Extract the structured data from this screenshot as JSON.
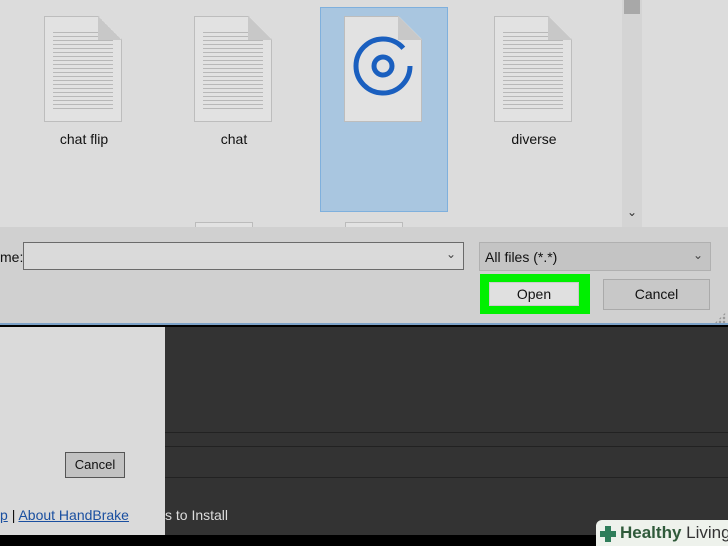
{
  "files": [
    {
      "name": "chat flip",
      "type": "text"
    },
    {
      "name": "chat",
      "type": "text"
    },
    {
      "name": "",
      "type": "groove-music",
      "selected": true
    },
    {
      "name": "diverse",
      "type": "text"
    }
  ],
  "dialog": {
    "filename_label": "me:",
    "filename_value": "",
    "filter": "All files (*.*)",
    "open_label": "Open",
    "cancel_label": "Cancel",
    "highlight_color": "#00f000"
  },
  "background_app": {
    "cancel_label": "Cancel",
    "link_help_fragment": "p",
    "separator": "|",
    "link_about": "About HandBrake",
    "install_fragment": "s to Install"
  },
  "watermark": {
    "brand_bold": "Healthy",
    "brand_light": " Living"
  }
}
